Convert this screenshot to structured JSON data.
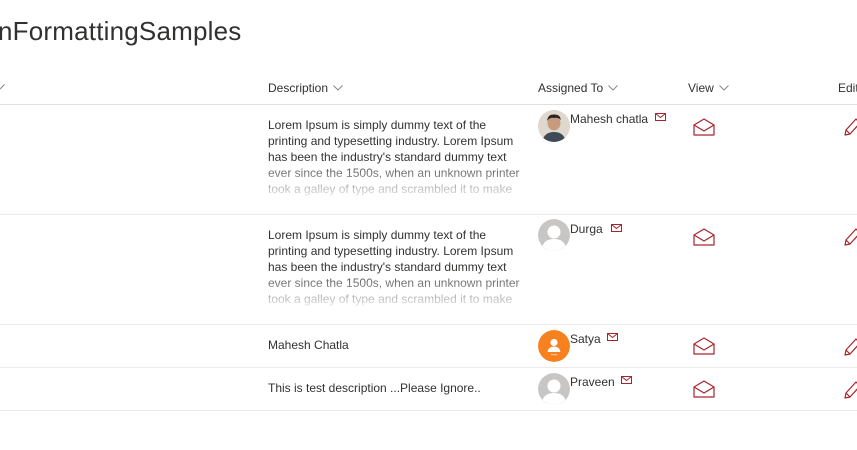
{
  "page": {
    "title": "nFormattingSamples"
  },
  "columns": {
    "description": "Description",
    "assigned_to": "Assigned To",
    "view": "View",
    "edit": "Edit"
  },
  "colors": {
    "accent": "#a4262c",
    "avatar_orange": "#f7811e",
    "avatar_gray": "#c8c6c4"
  },
  "rows": [
    {
      "description": "Lorem Ipsum is simply dummy text of the printing and typesetting industry. Lorem Ipsum has been the industry's standard dummy text ever since the 1500s, when an unknown printer took a galley of type and scrambled it to make",
      "assigned_to": "Mahesh chatla",
      "avatar": "photo"
    },
    {
      "description": "Lorem Ipsum is simply dummy text of the printing and typesetting industry. Lorem Ipsum has been the industry's standard dummy text ever since the 1500s, when an unknown printer took a galley of type and scrambled it to make",
      "assigned_to": "Durga",
      "avatar": "default"
    },
    {
      "description": "Mahesh Chatla",
      "assigned_to": "Satya",
      "avatar": "orange"
    },
    {
      "description": "This is test description ...Please Ignore..",
      "assigned_to": "Praveen",
      "avatar": "default"
    }
  ],
  "icons": {
    "sort": "chevron-down-icon",
    "email": "mail-icon",
    "view": "envelope-open-icon",
    "edit": "pencil-icon"
  }
}
